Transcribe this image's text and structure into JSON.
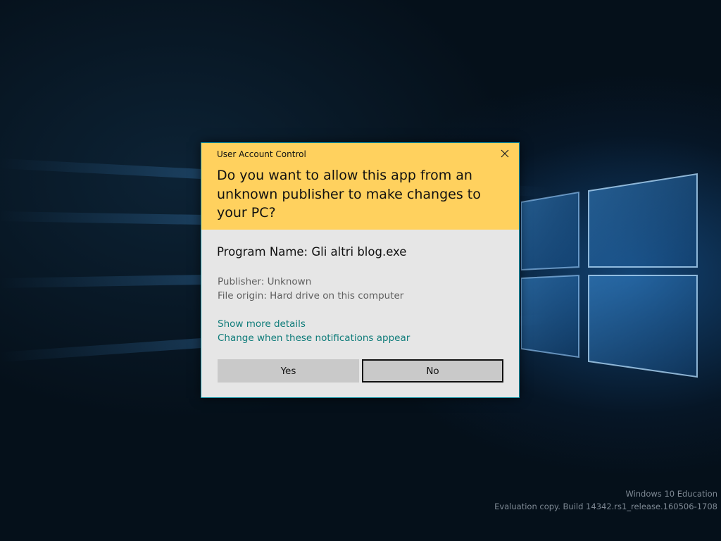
{
  "desktop": {
    "watermark": {
      "edition": "Windows 10 Education",
      "build": "Evaluation copy. Build 14342.rs1_release.160506-1708"
    }
  },
  "dialog": {
    "caption": "User Account Control",
    "question": "Do you want to allow this app from an unknown publisher to make changes to your PC?",
    "program_name": "Program Name: Gli altri blog.exe",
    "publisher": "Publisher: Unknown",
    "file_origin": "File origin: Hard drive on this computer",
    "links": {
      "show_details": "Show more details",
      "change_notifications": "Change when these notifications appear"
    },
    "buttons": {
      "yes": "Yes",
      "no": "No"
    },
    "header_color": "#ffd15e",
    "body_color": "#e6e6e6",
    "link_color": "#0f7c7a",
    "focused_button": "No"
  },
  "icons": {
    "close": "close-icon",
    "windows_logo": "windows-logo"
  }
}
